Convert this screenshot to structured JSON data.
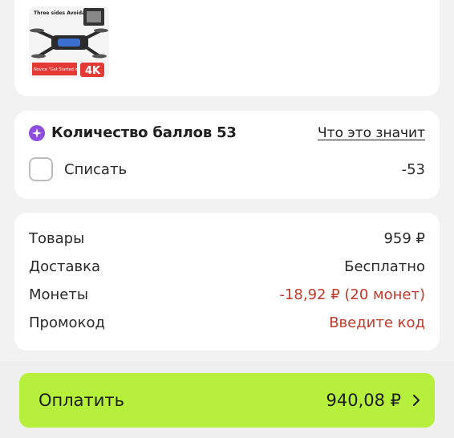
{
  "product": {
    "image_text_top": "Three sides Avoidance",
    "image_text_bottom": "Novice \"Get Started in a Second\"",
    "image_badge": "4K"
  },
  "points": {
    "title": "Количество баллов 53",
    "info_link": "Что это значит",
    "writeoff_label": "Списать",
    "writeoff_value": "-53",
    "writeoff_checked": false,
    "badge_color": "#8e4fe0"
  },
  "summary": {
    "rows": [
      {
        "label": "Товары",
        "value": "959 ₽"
      },
      {
        "label": "Доставка",
        "value": "Бесплатно"
      },
      {
        "label": "Монеты",
        "value": "-18,92 ₽ (20 монет)"
      },
      {
        "label": "Промокод",
        "value": "Введите код"
      }
    ],
    "accent_color": "#c0392b"
  },
  "pay": {
    "label": "Оплатить",
    "amount": "940,08 ₽",
    "button_color": "#b6f03c"
  }
}
